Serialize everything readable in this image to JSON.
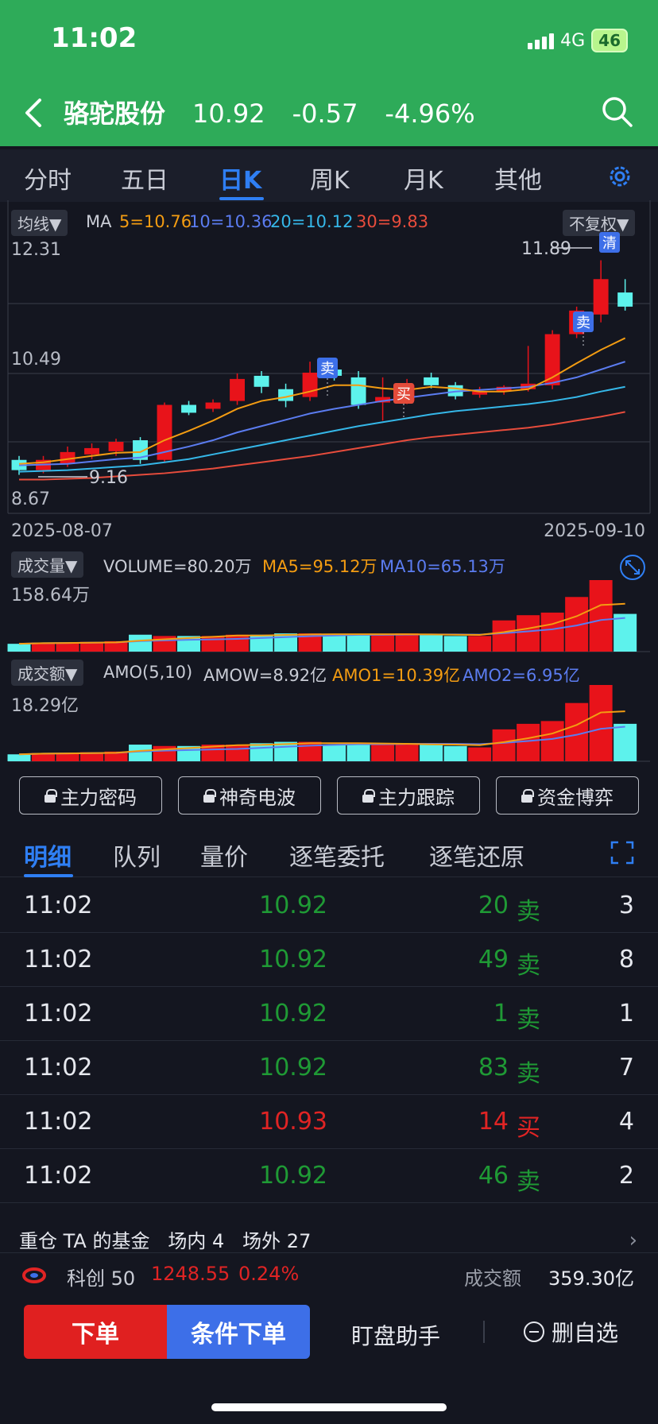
{
  "status": {
    "time": "11:02",
    "network": "4G",
    "battery": "46"
  },
  "header": {
    "name": "骆驼股份",
    "price": "10.92",
    "change": "-0.57",
    "pct": "-4.96%"
  },
  "tabs": [
    "分时",
    "五日",
    "日K",
    "周K",
    "月K",
    "其他"
  ],
  "kchart": {
    "ma_pill": "均线▼",
    "ma_label": "MA",
    "ma5": "5=10.76",
    "ma10": "10=10.36",
    "ma20": "20=10.12",
    "ma30": "30=9.83",
    "adjust": "不复权▼",
    "y_high": "12.31",
    "y_mid": "10.49",
    "y_low": "8.67",
    "max_label": "11.89",
    "min_label": "9.16",
    "date_start": "2025-08-07",
    "date_end": "2025-09-10",
    "sell1": "卖",
    "buy": "买",
    "sell2": "卖",
    "clear": "清"
  },
  "volume": {
    "pill": "成交量▼",
    "v": "VOLUME=80.20万",
    "ma5": "MA5=95.12万",
    "ma10": "MA10=65.13万",
    "ymax": "158.64万"
  },
  "amount": {
    "pill": "成交额▼",
    "name": "AMO(5,10)",
    "amow": "AMOW=8.92亿",
    "amo1": "AMO1=10.39亿",
    "amo2": "AMO2=6.95亿",
    "ymax": "18.29亿"
  },
  "tools": [
    "主力密码",
    "神奇电波",
    "主力跟踪",
    "资金博弈"
  ],
  "detail_tabs": [
    "明细",
    "队列",
    "量价",
    "逐笔委托",
    "逐笔还原"
  ],
  "trades": [
    {
      "time": "11:02",
      "price": "10.92",
      "vol": "20",
      "side": "卖",
      "count": "3",
      "color": "#1f9a35"
    },
    {
      "time": "11:02",
      "price": "10.92",
      "vol": "49",
      "side": "卖",
      "count": "8",
      "color": "#1f9a35"
    },
    {
      "time": "11:02",
      "price": "10.92",
      "vol": "1",
      "side": "卖",
      "count": "1",
      "color": "#1f9a35"
    },
    {
      "time": "11:02",
      "price": "10.92",
      "vol": "83",
      "side": "卖",
      "count": "7",
      "color": "#1f9a35"
    },
    {
      "time": "11:02",
      "price": "10.93",
      "vol": "14",
      "side": "买",
      "count": "4",
      "color": "#e02424"
    },
    {
      "time": "11:02",
      "price": "10.92",
      "vol": "46",
      "side": "卖",
      "count": "2",
      "color": "#1f9a35"
    }
  ],
  "fund": {
    "text": "重仓 TA 的基金",
    "inside": "场内 4",
    "outside": "场外 27"
  },
  "index": {
    "name": "科创 50",
    "value": "1248.55",
    "pct": "0.24%",
    "amt_label": "成交额",
    "amt": "359.30亿"
  },
  "bottom": {
    "order": "下单",
    "cond": "条件下单",
    "helper": "盯盘助手",
    "remove": "删自选"
  },
  "chart_data": {
    "type": "candlestick",
    "x_range": [
      "2025-08-07",
      "2025-09-10"
    ],
    "ylim": [
      8.67,
      12.31
    ],
    "candles": [
      {
        "o": 9.35,
        "c": 9.22,
        "h": 9.4,
        "l": 9.16
      },
      {
        "o": 9.22,
        "c": 9.35,
        "h": 9.4,
        "l": 9.18
      },
      {
        "o": 9.3,
        "c": 9.45,
        "h": 9.52,
        "l": 9.26
      },
      {
        "o": 9.42,
        "c": 9.5,
        "h": 9.56,
        "l": 9.36
      },
      {
        "o": 9.46,
        "c": 9.58,
        "h": 9.62,
        "l": 9.4
      },
      {
        "o": 9.6,
        "c": 9.35,
        "h": 9.64,
        "l": 9.3
      },
      {
        "o": 9.35,
        "c": 10.05,
        "h": 10.08,
        "l": 9.32
      },
      {
        "o": 10.05,
        "c": 9.95,
        "h": 10.1,
        "l": 9.92
      },
      {
        "o": 10.0,
        "c": 10.08,
        "h": 10.12,
        "l": 9.96
      },
      {
        "o": 10.1,
        "c": 10.38,
        "h": 10.45,
        "l": 10.05
      },
      {
        "o": 10.42,
        "c": 10.28,
        "h": 10.48,
        "l": 10.2
      },
      {
        "o": 10.25,
        "c": 10.1,
        "h": 10.32,
        "l": 10.02
      },
      {
        "o": 10.15,
        "c": 10.46,
        "h": 10.6,
        "l": 10.1
      },
      {
        "o": 10.5,
        "c": 10.42,
        "h": 10.55,
        "l": 10.36
      },
      {
        "o": 10.4,
        "c": 10.05,
        "h": 10.48,
        "l": 10.0
      },
      {
        "o": 10.08,
        "c": 10.15,
        "h": 10.4,
        "l": 9.85
      },
      {
        "o": 10.1,
        "c": 10.3,
        "h": 10.38,
        "l": 10.06
      },
      {
        "o": 10.4,
        "c": 10.3,
        "h": 10.46,
        "l": 10.26
      },
      {
        "o": 10.3,
        "c": 10.16,
        "h": 10.34,
        "l": 10.12
      },
      {
        "o": 10.18,
        "c": 10.22,
        "h": 10.28,
        "l": 10.14
      },
      {
        "o": 10.22,
        "c": 10.28,
        "h": 10.3,
        "l": 10.18
      },
      {
        "o": 10.25,
        "c": 10.32,
        "h": 10.8,
        "l": 10.22
      },
      {
        "o": 10.3,
        "c": 10.95,
        "h": 11.0,
        "l": 10.25
      },
      {
        "o": 10.95,
        "c": 11.25,
        "h": 11.3,
        "l": 10.9
      },
      {
        "o": 11.2,
        "c": 11.65,
        "h": 11.89,
        "l": 11.1
      },
      {
        "o": 11.48,
        "c": 11.3,
        "h": 11.65,
        "l": 11.25
      }
    ],
    "ma5": [
      9.3,
      9.32,
      9.36,
      9.4,
      9.44,
      9.45,
      9.6,
      9.72,
      9.85,
      10.0,
      10.1,
      10.15,
      10.22,
      10.3,
      10.3,
      10.26,
      10.24,
      10.28,
      10.26,
      10.22,
      10.22,
      10.25,
      10.4,
      10.58,
      10.75,
      10.9
    ],
    "ma10": [
      9.28,
      9.29,
      9.3,
      9.33,
      9.36,
      9.38,
      9.45,
      9.52,
      9.6,
      9.7,
      9.78,
      9.86,
      9.94,
      10.0,
      10.05,
      10.1,
      10.14,
      10.18,
      10.22,
      10.24,
      10.26,
      10.28,
      10.33,
      10.4,
      10.5,
      10.6
    ],
    "ma20": [
      9.2,
      9.21,
      9.22,
      9.24,
      9.26,
      9.28,
      9.32,
      9.36,
      9.42,
      9.48,
      9.54,
      9.6,
      9.66,
      9.72,
      9.78,
      9.83,
      9.88,
      9.93,
      9.97,
      10.0,
      10.03,
      10.06,
      10.1,
      10.15,
      10.22,
      10.28
    ],
    "ma30": [
      9.1,
      9.1,
      9.11,
      9.12,
      9.14,
      9.16,
      9.18,
      9.21,
      9.24,
      9.28,
      9.32,
      9.36,
      9.4,
      9.45,
      9.5,
      9.55,
      9.6,
      9.64,
      9.67,
      9.7,
      9.73,
      9.76,
      9.8,
      9.85,
      9.9,
      9.96
    ],
    "volume": [
      12,
      14,
      14,
      15,
      16,
      26,
      24,
      24,
      24,
      26,
      26,
      28,
      28,
      26,
      26,
      26,
      28,
      26,
      24,
      24,
      48,
      56,
      60,
      84,
      110,
      58
    ],
    "amount": [
      10,
      12,
      12,
      13,
      14,
      24,
      22,
      22,
      24,
      24,
      26,
      28,
      28,
      24,
      24,
      24,
      26,
      24,
      22,
      20,
      46,
      54,
      58,
      84,
      110,
      54
    ]
  }
}
